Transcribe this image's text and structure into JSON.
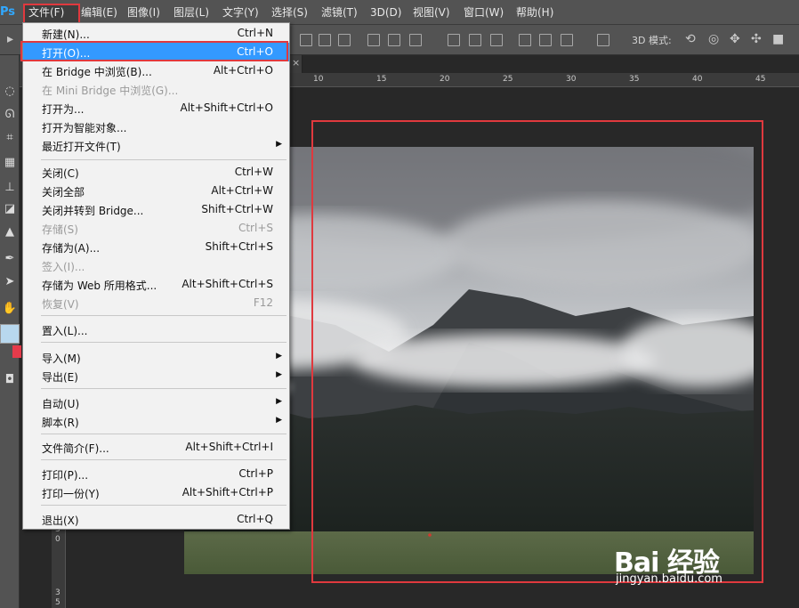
{
  "app": {
    "logo": "Ps"
  },
  "menubar": {
    "items": [
      "文件(F)",
      "编辑(E)",
      "图像(I)",
      "图层(L)",
      "文字(Y)",
      "选择(S)",
      "滤镜(T)",
      "3D(D)",
      "视图(V)",
      "窗口(W)",
      "帮助(H)"
    ]
  },
  "options_bar": {
    "mode_3d_label": "3D 模式:"
  },
  "document": {
    "close_glyph": "×"
  },
  "ruler": {
    "h_ticks": [
      "10",
      "15",
      "20",
      "25",
      "30",
      "35",
      "40",
      "45"
    ],
    "v_ticks": [
      "3",
      "0",
      "3",
      "5"
    ]
  },
  "file_menu": {
    "items": [
      {
        "label": "新建(N)...",
        "shortcut": "Ctrl+N",
        "disabled": false,
        "submenu": false
      },
      {
        "label": "打开(O)...",
        "shortcut": "Ctrl+O",
        "disabled": false,
        "submenu": false,
        "selected": true
      },
      {
        "label": "在 Bridge 中浏览(B)...",
        "shortcut": "Alt+Ctrl+O",
        "disabled": false,
        "submenu": false
      },
      {
        "label": "在 Mini Bridge 中浏览(G)...",
        "shortcut": "",
        "disabled": true,
        "submenu": false
      },
      {
        "label": "打开为...",
        "shortcut": "Alt+Shift+Ctrl+O",
        "disabled": false,
        "submenu": false
      },
      {
        "label": "打开为智能对象...",
        "shortcut": "",
        "disabled": false,
        "submenu": false
      },
      {
        "label": "最近打开文件(T)",
        "shortcut": "",
        "disabled": false,
        "submenu": true
      },
      {
        "label": "关闭(C)",
        "shortcut": "Ctrl+W",
        "disabled": false,
        "submenu": false
      },
      {
        "label": "关闭全部",
        "shortcut": "Alt+Ctrl+W",
        "disabled": false,
        "submenu": false
      },
      {
        "label": "关闭并转到 Bridge...",
        "shortcut": "Shift+Ctrl+W",
        "disabled": false,
        "submenu": false
      },
      {
        "label": "存储(S)",
        "shortcut": "Ctrl+S",
        "disabled": true,
        "submenu": false
      },
      {
        "label": "存储为(A)...",
        "shortcut": "Shift+Ctrl+S",
        "disabled": false,
        "submenu": false
      },
      {
        "label": "签入(I)...",
        "shortcut": "",
        "disabled": true,
        "submenu": false
      },
      {
        "label": "存储为 Web 所用格式...",
        "shortcut": "Alt+Shift+Ctrl+S",
        "disabled": false,
        "submenu": false
      },
      {
        "label": "恢复(V)",
        "shortcut": "F12",
        "disabled": true,
        "submenu": false
      },
      {
        "label": "置入(L)...",
        "shortcut": "",
        "disabled": false,
        "submenu": false
      },
      {
        "label": "导入(M)",
        "shortcut": "",
        "disabled": false,
        "submenu": true
      },
      {
        "label": "导出(E)",
        "shortcut": "",
        "disabled": false,
        "submenu": true
      },
      {
        "label": "自动(U)",
        "shortcut": "",
        "disabled": false,
        "submenu": true
      },
      {
        "label": "脚本(R)",
        "shortcut": "",
        "disabled": false,
        "submenu": true
      },
      {
        "label": "文件简介(F)...",
        "shortcut": "Alt+Shift+Ctrl+I",
        "disabled": false,
        "submenu": false
      },
      {
        "label": "打印(P)...",
        "shortcut": "Ctrl+P",
        "disabled": false,
        "submenu": false
      },
      {
        "label": "打印一份(Y)",
        "shortcut": "Alt+Shift+Ctrl+P",
        "disabled": false,
        "submenu": false
      },
      {
        "label": "退出(X)",
        "shortcut": "Ctrl+Q",
        "disabled": false,
        "submenu": false
      }
    ],
    "submenu_glyph": "▶"
  },
  "watermark": {
    "brand": "Bai 经验",
    "url": "jingyan.baidu.com"
  },
  "colors": {
    "menu_bg": "#f2f2f2",
    "selection": "#3399ff",
    "annotation_red": "#e0393e",
    "ui_dark": "#535353"
  },
  "icons": {
    "mode_3d": [
      "rotate-3d-icon",
      "roll-3d-icon",
      "pan-3d-icon",
      "slide-3d-icon",
      "camera-3d-icon"
    ]
  }
}
